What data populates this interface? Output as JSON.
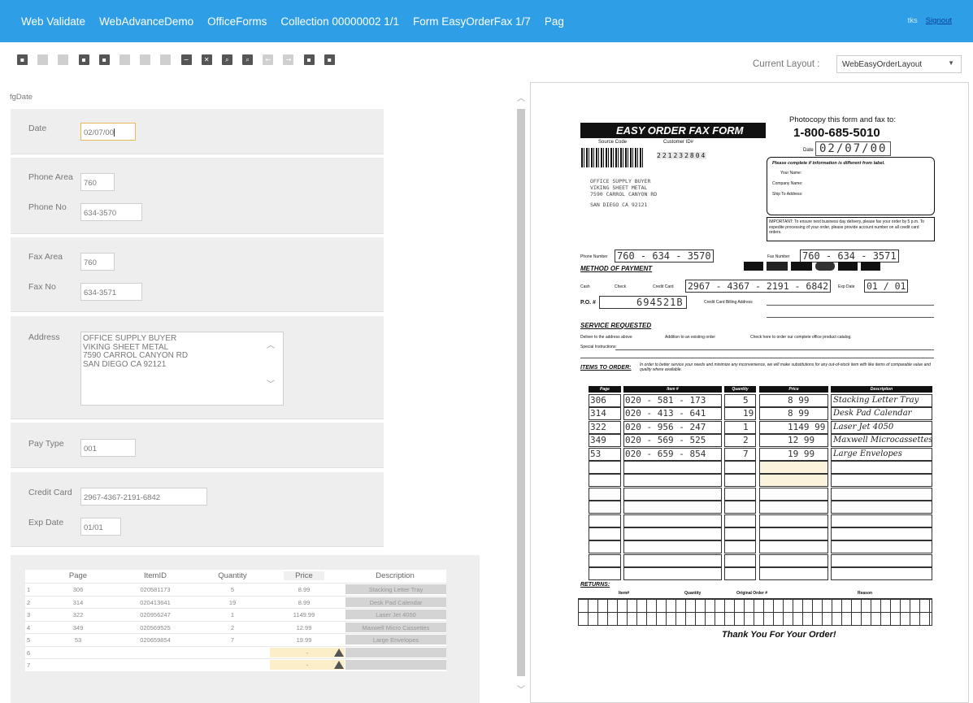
{
  "header": {
    "breadcrumbs": [
      "Web Validate",
      "WebAdvanceDemo",
      "OfficeForms",
      "Collection 00000002 1/1",
      "Form EasyOrderFax 1/7",
      "Pag"
    ],
    "user": "tks",
    "signout": "Signout"
  },
  "toolbar": {
    "layout_label": "Current Layout :",
    "layout_value": "WebEasyOrderLayout",
    "icons": [
      "save-icon",
      "copy-icon",
      "paste-icon",
      "save-all-icon",
      "delete-icon",
      "page-icon",
      "insert-page-icon",
      "remove-page-icon",
      "minus-icon",
      "fit-icon",
      "zoom-in-icon",
      "zoom-out-icon",
      "prev-icon",
      "next-icon",
      "split-left-icon",
      "split-right-icon"
    ]
  },
  "form": {
    "field_name": "fgDate",
    "date": {
      "label": "Date",
      "value": "02/07/00"
    },
    "phone_area": {
      "label": "Phone Area",
      "value": "760"
    },
    "phone_no": {
      "label": "Phone No",
      "value": "634-3570"
    },
    "fax_area": {
      "label": "Fax Area",
      "value": "760"
    },
    "fax_no": {
      "label": "Fax No",
      "value": "634-3571"
    },
    "address": {
      "label": "Address",
      "lines": [
        "OFFICE SUPPLY BUYER",
        "VIKING SHEET METAL",
        "7590 CARROL CANYON RD",
        "SAN DIEGO CA 92121"
      ]
    },
    "pay_type": {
      "label": "Pay Type",
      "value": "001"
    },
    "credit_card": {
      "label": "Credit Card",
      "value": "2967-4367-2191-6842"
    },
    "exp_date": {
      "label": "Exp Date",
      "value": "01/01"
    }
  },
  "table": {
    "columns": [
      "Page",
      "ItemID",
      "Quantity",
      "Price",
      "Description"
    ],
    "rows": [
      {
        "n": "1",
        "page": "306",
        "item": "020581173",
        "qty": "5",
        "price": "8.99",
        "desc": "Stacking Letter Tray"
      },
      {
        "n": "2",
        "page": "314",
        "item": "020413641",
        "qty": "19",
        "price": "8.99",
        "desc": "Desk Pad Calendar"
      },
      {
        "n": "3",
        "page": "322",
        "item": "020956247",
        "qty": "1",
        "price": "1149.99",
        "desc": "Laser Jet 4050"
      },
      {
        "n": "4",
        "page": "349",
        "item": "020569525",
        "qty": "2",
        "price": "12.99",
        "desc": "Maxwell Micro Cassettes"
      },
      {
        "n": "5",
        "page": "53",
        "item": "020659854",
        "qty": "7",
        "price": "19.99",
        "desc": "Large Envelopes"
      },
      {
        "n": "6",
        "page": "",
        "item": "",
        "qty": "",
        "price": "-",
        "desc": ""
      },
      {
        "n": "7",
        "page": "",
        "item": "",
        "qty": "",
        "price": "-",
        "desc": ""
      }
    ]
  },
  "doc": {
    "title": "EASY ORDER FAX FORM",
    "source_code": "Source Code",
    "customer_id": "Customer ID#",
    "customer_num": "221232804",
    "photocopy": "Photocopy this form and fax to:",
    "phone": "1-800-685-5010",
    "date_label": "Date",
    "date_value": "02/07/00",
    "complete_note": "Please complete if information is different from label.",
    "your_name": "Your Name:",
    "company_name": "Company Name:",
    "ship_to": "Ship To Address:",
    "important": "IMPORTANT: To ensure next business day delivery, please fax your order by 5 p.m. To expedite processing of your order, please provide account number on all credit card orders.",
    "address_lines": [
      "OFFICE SUPPLY BUYER",
      "VIKING SHEET METAL",
      "7590 CARROL CANYON RD",
      "SAN DIEGO CA 92121"
    ],
    "phone_number_label": "Phone Number",
    "phone_number": "760 - 634 - 3570",
    "fax_number_label": "Fax Number",
    "fax_number": "760 - 634 - 3571",
    "method": "METHOD OF PAYMENT",
    "cash": "Cash",
    "check": "Check",
    "credit_card": "Credit Card",
    "cc_number": "2967 - 4367 - 2191 - 6842",
    "exp_date_label": "Exp Date",
    "exp_date": "01 / 01",
    "po": "P.O. #",
    "po_value": "694521B",
    "billing": "Credit Card Billing Address",
    "service": "SERVICE REQUESTED",
    "deliver": "Deliver to the address above",
    "addition": "Addition to an existing order",
    "catalog": "Check here to order our complete office product catalog.",
    "special": "Special Instructions:",
    "items_to_order": "ITEMS TO ORDER:",
    "items_note": "In order to better service your needs and minimize any inconvenience, we will make substitutions for any out-of-stock item with like items of comparable value and quality where available.",
    "item_cols": [
      "Page",
      "Item #",
      "Quantity",
      "Price",
      "Description"
    ],
    "item_rows": [
      [
        "306",
        "020 - 581 - 173",
        "5",
        "8 99",
        "Stacking Letter Tray"
      ],
      [
        "314",
        "020 - 413 - 641",
        "19",
        "8 99",
        "Desk Pad Calendar"
      ],
      [
        "322",
        "020 - 956 - 247",
        "1",
        "1149 99",
        "Laser Jet 4050"
      ],
      [
        "349",
        "020 - 569 - 525",
        "2",
        "12 99",
        "Maxwell Microcassettes"
      ],
      [
        "53",
        "020 - 659 - 854",
        "7",
        "19 99",
        "Large Envelopes"
      ]
    ],
    "returns": "RETURNS:",
    "ret_cols": [
      "Item#",
      "Quantity",
      "Original Order #",
      "Reason"
    ],
    "thanks": "Thank You For Your Order!"
  }
}
